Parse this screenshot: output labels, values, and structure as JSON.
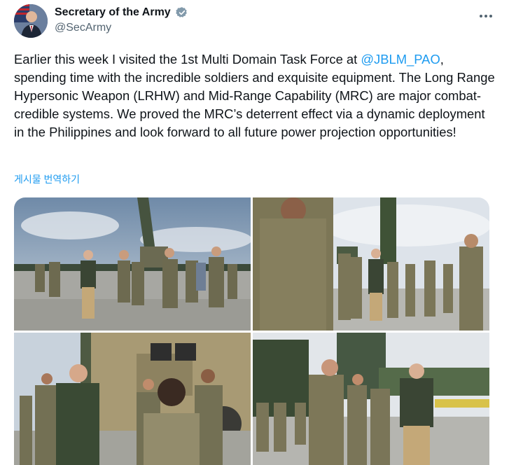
{
  "author": {
    "display_name": "Secretary of the Army",
    "handle": "@SecArmy",
    "verified_icon": "verified-badge-icon"
  },
  "post": {
    "text_before_mention": "Earlier this week I visited the 1st Multi Domain Task Force at ",
    "mention": "@JBLM_PAO",
    "text_after_mention": ", spending time with the incredible soldiers and exquisite equipment. The Long Range Hypersonic Weapon (LRHW) and Mid-Range Capability (MRC) are major combat-credible systems. We proved the MRC’s deterrent effect via a dynamic deployment in the Philippines and look forward to all future power projection opportunities!",
    "translate_label": "게시물 번역하기"
  },
  "media": {
    "photos": [
      {
        "name": "photo-group-walking"
      },
      {
        "name": "photo-briefing-line"
      },
      {
        "name": "photo-vehicle-briefing"
      },
      {
        "name": "photo-launcher-talk"
      }
    ]
  },
  "colors": {
    "accent": "#1d9bf0",
    "text": "#0f1419",
    "secondary": "#536471"
  }
}
